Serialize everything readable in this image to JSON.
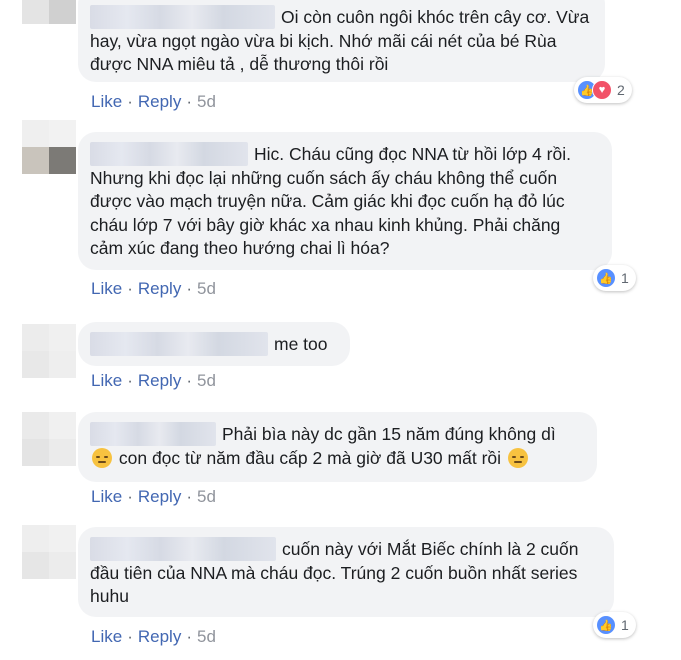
{
  "comments": [
    {
      "text": "Oi còn cuôn ngôi khóc trên cây cơ. Vừa hay, vừa ngọt ngào vừa bi kịch. Nhớ mãi cái nét của bé Rùa được NNA miêu tả , dễ thương thôi rồi",
      "actions": {
        "like": "Like",
        "reply": "Reply",
        "time": "5d"
      },
      "reactions": {
        "icons": [
          "like-icon",
          "love-icon"
        ],
        "count": "2"
      }
    },
    {
      "text": "Hic. Cháu cũng đọc NNA từ hồi lớp 4 rồi. Nhưng khi đọc lại những cuốn sách ấy cháu không thể cuốn được vào mạch truyện nữa. Cảm giác khi đọc cuốn hạ đỏ lúc cháu lớp 7 với bây giờ khác xa nhau kinh khủng. Phải chăng cảm xúc đang theo hướng chai lì hóa?",
      "actions": {
        "like": "Like",
        "reply": "Reply",
        "time": "5d"
      },
      "reactions": {
        "icons": [
          "like-icon"
        ],
        "count": "1"
      }
    },
    {
      "text": "me too",
      "actions": {
        "like": "Like",
        "reply": "Reply",
        "time": "5d"
      }
    },
    {
      "text_line1": "Phải bìa này dc gần 15 năm đúng không dì",
      "text_line2": "con đọc từ năm đầu cấp 2 mà giờ đã U30 mất rồi",
      "emoji": "disappointed-face-icon",
      "actions": {
        "like": "Like",
        "reply": "Reply",
        "time": "5d"
      }
    },
    {
      "text": "cuốn này với Mắt Biếc chính là 2 cuốn đầu tiên của NNA mà cháu đọc. Trúng 2 cuốn buồn nhất series huhu",
      "actions": {
        "like": "Like",
        "reply": "Reply",
        "time": "5d"
      },
      "reactions": {
        "icons": [
          "like-icon"
        ],
        "count": "1"
      }
    }
  ],
  "colors": {
    "bubble": "#f2f3f5",
    "link": "#4267b2",
    "time": "#90949c",
    "text": "#1c1e21",
    "like": "#5890ff",
    "love": "#f25268"
  }
}
